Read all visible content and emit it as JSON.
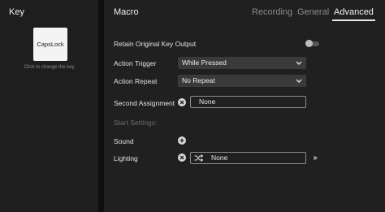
{
  "key_panel": {
    "title": "Key",
    "key_label": "CapsLock",
    "hint": "Click to change the key"
  },
  "macro_panel": {
    "title": "Macro",
    "tabs": [
      {
        "label": "Recording",
        "active": false
      },
      {
        "label": "General",
        "active": false
      },
      {
        "label": "Advanced",
        "active": true
      }
    ],
    "retain_label": "Retain Original Key Output",
    "retain_enabled": false,
    "action_trigger": {
      "label": "Action Trigger",
      "value": "While Pressed"
    },
    "action_repeat": {
      "label": "Action Repeat",
      "value": "No Repeat"
    },
    "second_assignment": {
      "label": "Second Assignment",
      "value": "None"
    },
    "start_settings_label": "Start Settings:",
    "sound_label": "Sound",
    "lighting": {
      "label": "Lighting",
      "value": "None"
    }
  },
  "icons": {
    "clear": "close-icon",
    "add": "plus-icon",
    "shuffle": "shuffle-icon",
    "dropdown": "chevron-down-icon",
    "play": "play-icon"
  },
  "colors": {
    "background": "#1c1c1c",
    "panel": "#202020",
    "select_bg": "#3a3a3a",
    "accent": "#e8e8e8"
  }
}
